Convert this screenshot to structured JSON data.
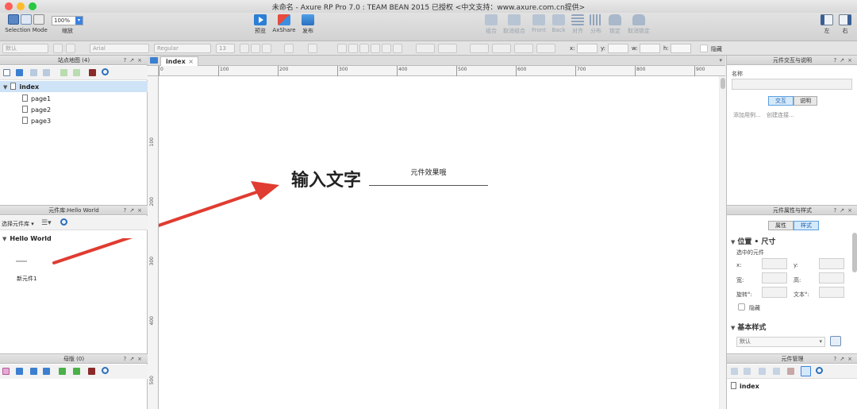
{
  "window": {
    "title": "未命名 - Axure RP Pro 7.0 : TEAM BEAN 2015 已授权      <中文支持：www.axure.com.cn提供>"
  },
  "toolbar": {
    "selection_mode": "Selection Mode",
    "zoom_value": "100%",
    "zoom_label": "缩放",
    "preview": "预览",
    "axshare": "AxShare",
    "publish": "发布",
    "group": "组合",
    "ungroup": "取消组合",
    "front": "Front",
    "back": "Back",
    "align": "对齐",
    "distribute": "分布",
    "lock": "锁定",
    "unlock": "取消锁定",
    "left": "左",
    "right": "右"
  },
  "formatbar": {
    "style": "默认",
    "font": "Arial",
    "weight": "Regular",
    "size": "13",
    "x_label": "x:",
    "y_label": "y:",
    "w_label": "w:",
    "h_label": "h:",
    "hidden_label": "隐藏"
  },
  "sitemap": {
    "title": "站点地图 (4)",
    "root": "index",
    "pages": [
      "page1",
      "page2",
      "page3"
    ]
  },
  "library": {
    "title": "元件库:Hello World",
    "select_label": "选择元件库",
    "group_name": "Hello World",
    "widget_name": "新元件1"
  },
  "masters": {
    "title": "母版 (0)"
  },
  "editor": {
    "tab_label": "index",
    "ruler_h": [
      "0",
      "100",
      "200",
      "300",
      "400",
      "500",
      "600",
      "700",
      "800",
      "900"
    ],
    "ruler_v": [
      "100",
      "200",
      "300",
      "400",
      "500"
    ],
    "heading_text": "输入文字",
    "input_text": "元件效果哦"
  },
  "interactions": {
    "title": "元件交互与说明",
    "name_label": "名称",
    "tab_interact": "交互",
    "tab_notes": "说明",
    "add_case": "添加用例...",
    "create_link": "创建连接..."
  },
  "properties": {
    "title": "元件属性与样式",
    "tab_props": "属性",
    "tab_style": "样式",
    "section_pos": "位置 • 尺寸",
    "selected_label": "选中的元件",
    "x_label": "x:",
    "y_label": "y:",
    "w_label": "宽:",
    "h_label": "高:",
    "rot_label": "旋转°:",
    "text_label": "文本°:",
    "hidden_label": "隐藏",
    "section_base": "基本样式",
    "style_value": "默认"
  },
  "outline": {
    "title": "元件管理",
    "item": "index"
  },
  "colors": {
    "accent": "#4a90d9",
    "arrow": "#e03c31",
    "selection": "#cfe3f7"
  }
}
